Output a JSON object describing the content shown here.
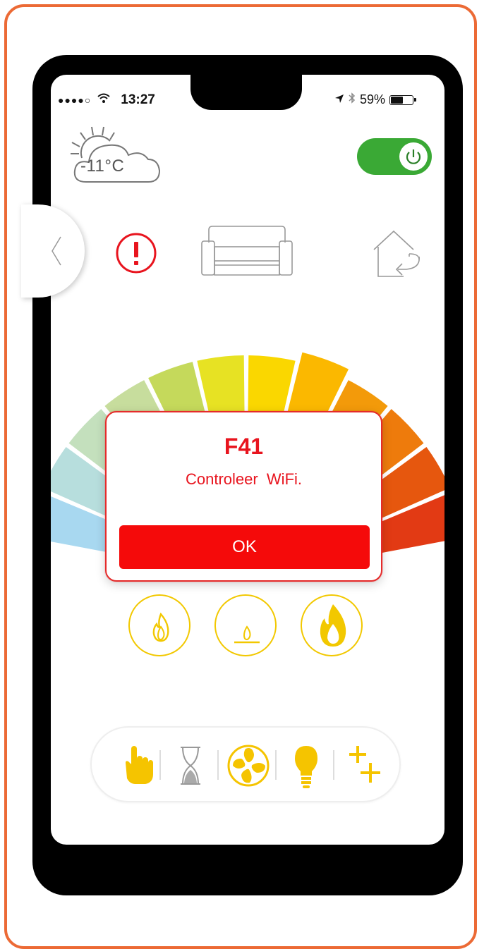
{
  "status_bar": {
    "signal_dots": "●●●●○",
    "wifi_icon": "wifi-icon",
    "time": "13:27",
    "location_icon": "location-arrow-icon",
    "bluetooth_icon": "bluetooth-icon",
    "battery_percent": "59%",
    "battery_level": 0.59
  },
  "weather": {
    "temperature": "-11°C",
    "icon": "partly-sunny-cloud-icon"
  },
  "power_toggle": {
    "state": "on",
    "icon": "power-icon",
    "color": "#3aa935"
  },
  "nav_row": {
    "back_icon": "chevron-left-icon",
    "alert_icon": "exclamation-circle-icon",
    "alert_color": "#e8141e",
    "room_icon": "sofa-icon",
    "exit_icon": "house-return-icon"
  },
  "gauge": {
    "segments": 12,
    "colors": [
      "#a8d8f0",
      "#b7dedd",
      "#c4e0bd",
      "#c7dd9d",
      "#c5d95b",
      "#e7e223",
      "#fad700",
      "#fbb800",
      "#f39a0a",
      "#ee7b0c",
      "#e6570e",
      "#e23a14"
    ],
    "selected_segment": 7
  },
  "error_dialog": {
    "code": "F41",
    "message": "Controleer  WiFi.",
    "ok_label": "OK",
    "accent_color": "#e8141e"
  },
  "flame_modes": [
    {
      "name": "flame-medium-icon"
    },
    {
      "name": "pilot-flame-icon"
    },
    {
      "name": "flame-large-icon"
    }
  ],
  "toolbar": {
    "items": [
      {
        "name": "hand-manual-icon"
      },
      {
        "name": "hourglass-timer-icon"
      },
      {
        "name": "fan-icon"
      },
      {
        "name": "light-bulb-icon"
      },
      {
        "name": "plus-extras-icon"
      }
    ],
    "active_color": "#f5c400"
  }
}
